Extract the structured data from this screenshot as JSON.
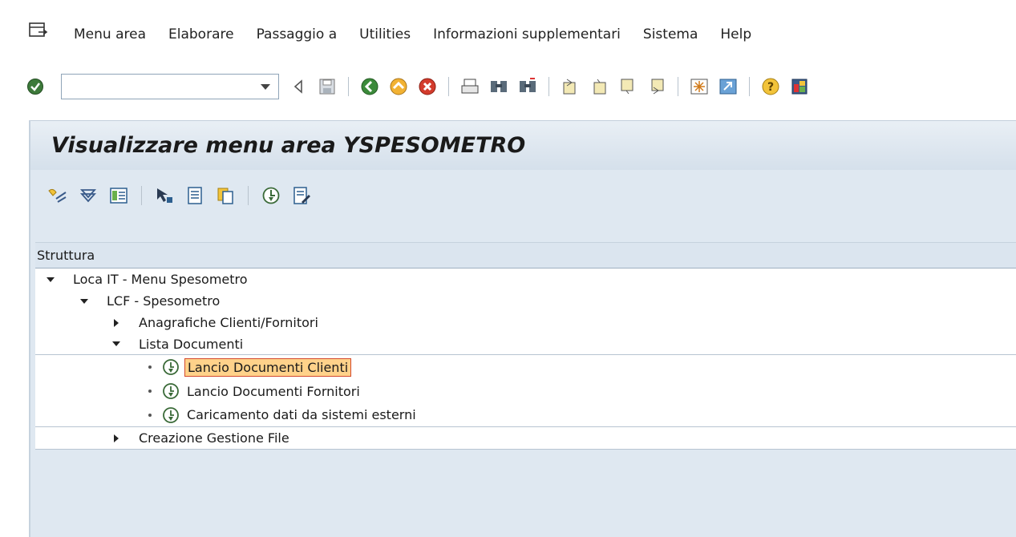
{
  "menubar": {
    "items": [
      "Menu area",
      "Elaborare",
      "Passaggio a",
      "Utilities",
      "Informazioni supplementari",
      "Sistema",
      "Help"
    ]
  },
  "toolbar": {
    "command_field_value": ""
  },
  "title": "Visualizzare menu area YSPESOMETRO",
  "tree": {
    "header": "Struttura",
    "nodes": [
      {
        "label": "Loca IT - Menu Spesometro",
        "level": 0,
        "state": "expanded"
      },
      {
        "label": "LCF - Spesometro",
        "level": 1,
        "state": "expanded"
      },
      {
        "label": "Anagrafiche Clienti/Fornitori",
        "level": 2,
        "state": "collapsed"
      },
      {
        "label": "Lista Documenti",
        "level": 2,
        "state": "expanded"
      },
      {
        "label": "Lancio Documenti Clienti",
        "level": 3,
        "state": "leaf",
        "selected": true
      },
      {
        "label": "Lancio Documenti Fornitori",
        "level": 3,
        "state": "leaf"
      },
      {
        "label": "Caricamento dati da sistemi esterni",
        "level": 3,
        "state": "leaf"
      },
      {
        "label": "Creazione Gestione File",
        "level": 2,
        "state": "collapsed"
      }
    ]
  },
  "colors": {
    "accent_selected_bg": "#ffd28a",
    "accent_selected_border": "#d34a2e",
    "frame_bg": "#dfe8f1"
  }
}
